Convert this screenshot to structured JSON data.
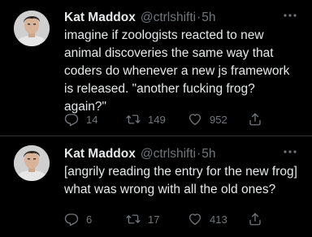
{
  "tweets": [
    {
      "author": {
        "name": "Kat Maddox",
        "handle": "@ctrlshifti",
        "avatar_icon": "user-avatar-photo"
      },
      "separator": "·",
      "time": "5h",
      "text": "imagine if zoologists reacted to new animal discoveries the same way that coders do whenever a new js framework is released. \"another fucking frog? again?\"",
      "stats": {
        "replies": "14",
        "retweets": "149",
        "likes": "952"
      }
    },
    {
      "author": {
        "name": "Kat Maddox",
        "handle": "@ctrlshifti",
        "avatar_icon": "user-avatar-photo"
      },
      "separator": "·",
      "time": "5h",
      "text": "[angrily reading the entry for the new frog] what was wrong with all the old ones?",
      "stats": {
        "replies": "6",
        "retweets": "17",
        "likes": "413"
      }
    }
  ],
  "icons": {
    "reply": "reply-icon",
    "retweet": "retweet-icon",
    "like": "heart-icon",
    "share": "share-icon",
    "more": "more-options-icon"
  },
  "colors": {
    "background": "#000000",
    "text_primary": "#e7e9ea",
    "text_secondary": "#71767b",
    "divider": "#2f3336"
  }
}
